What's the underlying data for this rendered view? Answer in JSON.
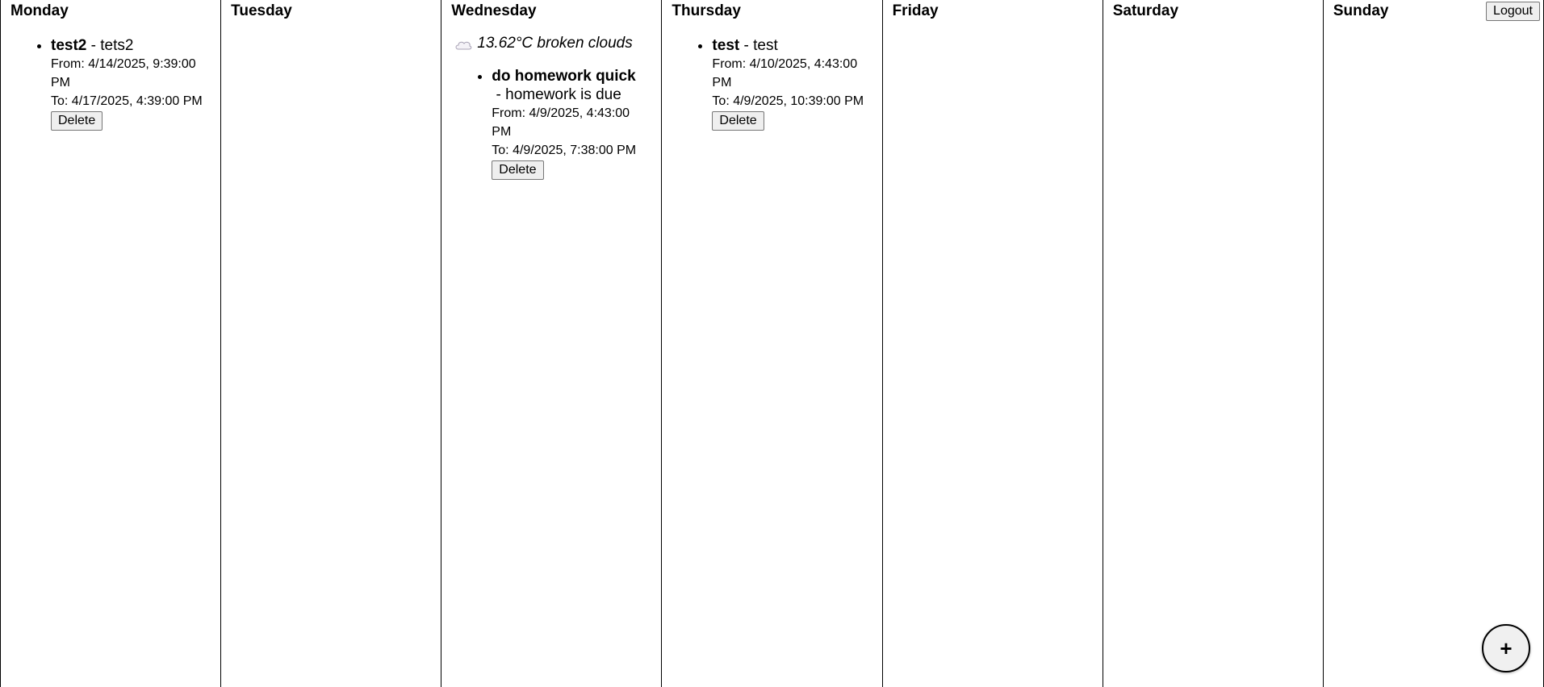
{
  "days": [
    {
      "name": "Monday"
    },
    {
      "name": "Tuesday"
    },
    {
      "name": "Wednesday"
    },
    {
      "name": "Thursday"
    },
    {
      "name": "Friday"
    },
    {
      "name": "Saturday"
    },
    {
      "name": "Sunday"
    }
  ],
  "weather": {
    "wednesday": {
      "text": "13.62°C broken clouds",
      "icon": "cloud-icon"
    }
  },
  "events": {
    "monday": [
      {
        "title": "test2",
        "separator": " - ",
        "description": "tets2",
        "from": "From: 4/14/2025, 9:39:00 PM",
        "to": "To: 4/17/2025, 4:39:00 PM",
        "delete_label": "Delete"
      }
    ],
    "wednesday": [
      {
        "title": "do homework quick",
        "separator": " - ",
        "description": "homework is due",
        "from": "From: 4/9/2025, 4:43:00 PM",
        "to": "To: 4/9/2025, 7:38:00 PM",
        "delete_label": "Delete"
      }
    ],
    "thursday": [
      {
        "title": "test",
        "separator": " - ",
        "description": "test",
        "from": "From: 4/10/2025, 4:43:00 PM",
        "to": "To: 4/9/2025, 10:39:00 PM",
        "delete_label": "Delete"
      }
    ]
  },
  "header": {
    "logout_label": "Logout"
  },
  "fab": {
    "label": "+",
    "icon": "plus-icon"
  }
}
